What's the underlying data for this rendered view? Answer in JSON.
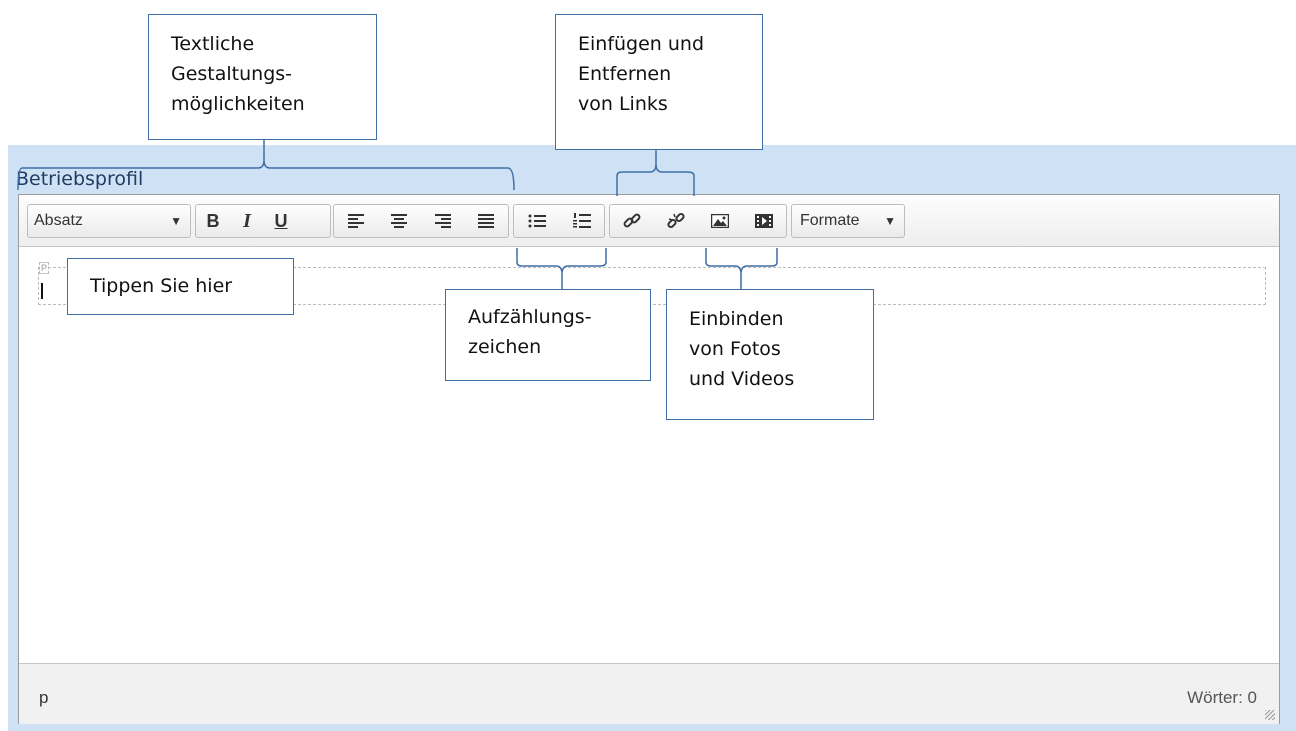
{
  "field": {
    "label": "Betriebsprofil"
  },
  "toolbar": {
    "block_format": "Absatz",
    "bold": "B",
    "italic": "I",
    "underline": "U",
    "formats_label": "Formate"
  },
  "icons": {
    "align_left": "align-left-icon",
    "align_center": "align-center-icon",
    "align_right": "align-right-icon",
    "justify": "justify-icon",
    "bullet_list": "bullet-list-icon",
    "numbered_list": "numbered-list-icon",
    "link": "link-icon",
    "unlink": "unlink-icon",
    "image": "image-icon",
    "video": "video-icon"
  },
  "editor": {
    "element_marker": "P"
  },
  "statusbar": {
    "path": "p",
    "word_count": "Wörter: 0"
  },
  "annotations": {
    "text_formatting": [
      "Textliche",
      "Gestaltungs-",
      "möglichkeiten"
    ],
    "links": [
      "Einfügen und",
      "Entfernen",
      "von Links"
    ],
    "type_here": [
      "Tippen Sie hier"
    ],
    "lists": [
      "Aufzählungs-",
      "zeichen"
    ],
    "media": [
      "Einbinden",
      "von Fotos",
      "und Videos"
    ]
  },
  "colors": {
    "panel_bg": "#cfe2f5",
    "callout_border": "#3f6fa6",
    "label_text": "#1f3d63"
  }
}
